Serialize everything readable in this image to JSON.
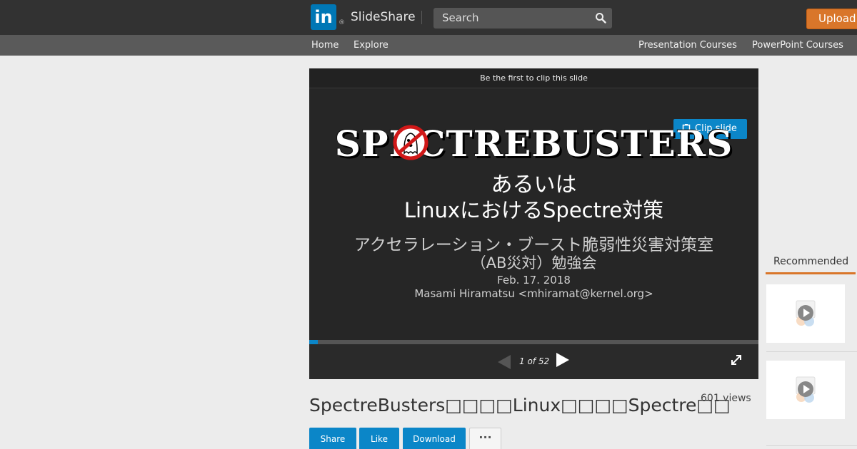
{
  "header": {
    "logo_text": "in",
    "logo_mark": "®",
    "brand": "SlideShare",
    "search_placeholder": "Search",
    "upload_label": "Upload"
  },
  "subnav": {
    "home": "Home",
    "explore": "Explore",
    "presentation_courses": "Presentation Courses",
    "powerpoint_courses": "PowerPoint Courses"
  },
  "player": {
    "clip_banner": "Be the first to clip this slide",
    "clip_button": "Clip slide",
    "counter": "1 of 52",
    "progress_fraction": 0.019,
    "slide": {
      "title": "SPECTREBUSTERS",
      "line1": "あるいは",
      "line2": "LinuxにおけるSpectre対策",
      "line3": "アクセラレーション・ブースト脆弱性災害対策室",
      "line4": "（AB災対）勉強会",
      "line5": "Feb. 17. 2018",
      "line6": "Masami Hiramatsu <mhiramat@kernel.org>"
    }
  },
  "document": {
    "title": "SpectreBusters□□□□Linux□□□□Spectre□□",
    "views": "601 views"
  },
  "actions": {
    "share": "Share",
    "like": "Like",
    "download": "Download",
    "more": "···"
  },
  "recommended": {
    "title": "Recommended"
  },
  "colors": {
    "accent_blue": "#0b86c8",
    "upload_orange": "#d9762a",
    "topbar": "#323232",
    "linkedin": "#0077b5"
  }
}
